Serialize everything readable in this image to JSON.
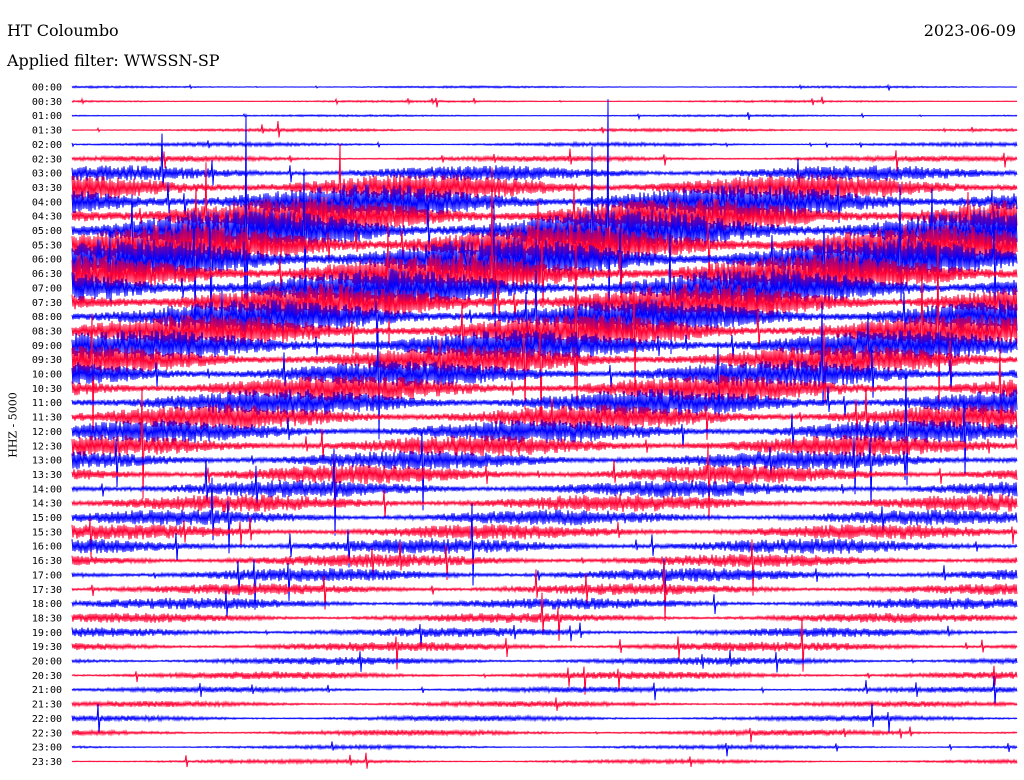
{
  "header": {
    "station": "HT Coloumbo",
    "date": "2023-06-09",
    "filter": "Applied filter: WWSSN-SP"
  },
  "chart_data": {
    "type": "line",
    "title": "HT Coloumbo",
    "ylabel": "HHZ - 5000",
    "row_labels": [
      "00:00",
      "00:30",
      "01:00",
      "01:30",
      "02:00",
      "02:30",
      "03:00",
      "03:30",
      "04:00",
      "04:30",
      "05:00",
      "05:30",
      "06:00",
      "06:30",
      "07:00",
      "07:30",
      "08:00",
      "08:30",
      "09:00",
      "09:30",
      "10:00",
      "10:30",
      "11:00",
      "11:30",
      "12:00",
      "12:30",
      "13:00",
      "13:30",
      "14:00",
      "14:30",
      "15:00",
      "15:30",
      "16:00",
      "16:30",
      "17:00",
      "17:30",
      "18:00",
      "18:30",
      "19:00",
      "19:30",
      "20:00",
      "20:30",
      "21:00",
      "21:30",
      "22:00",
      "22:30",
      "23:00",
      "23:30"
    ],
    "row_colors": [
      "#0000ff",
      "#ff0033"
    ],
    "row_amplitude": [
      1,
      1,
      1,
      1.5,
      2,
      3,
      8,
      14,
      18,
      20,
      22,
      22,
      22,
      21,
      20,
      19,
      18,
      17,
      16,
      15,
      14,
      14,
      14,
      13,
      12,
      11,
      10,
      10,
      9,
      9,
      8,
      8,
      8,
      7,
      7,
      6,
      6,
      5,
      5,
      5,
      4,
      4,
      3,
      3,
      3,
      3,
      2,
      2
    ],
    "grid": false
  }
}
